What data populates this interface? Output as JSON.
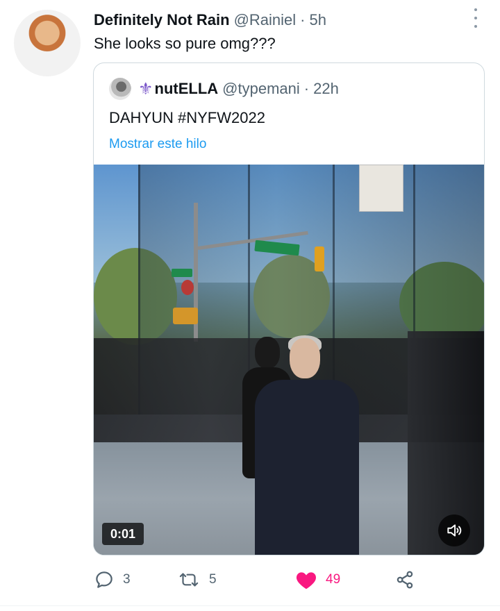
{
  "tweet": {
    "display_name": "Definitely Not Rain",
    "handle": "@Rainiel",
    "separator": "·",
    "time": "5h",
    "text": "She looks so pure omg???"
  },
  "quoted_tweet": {
    "name_symbol": "⚜",
    "display_name": "nutELLA",
    "handle": "@typemani",
    "separator": "·",
    "time": "22h",
    "text": "DAHYUN #NYFW2022",
    "thread_link": "Mostrar este hilo",
    "media": {
      "duration": "0:01",
      "volume_icon": "speaker-icon"
    }
  },
  "actions": {
    "reply_count": "3",
    "retweet_count": "5",
    "like_count": "49",
    "liked": true,
    "like_color": "#f91880",
    "muted_color": "#536471"
  }
}
